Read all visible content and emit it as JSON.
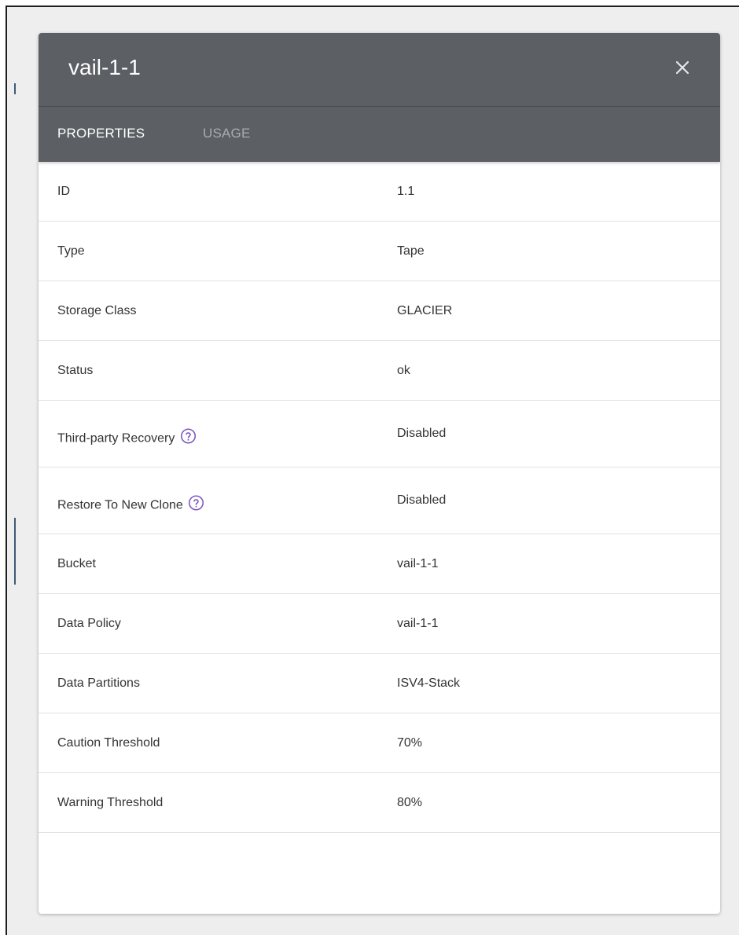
{
  "dialog": {
    "title": "vail-1-1",
    "close_icon": "close-icon"
  },
  "tabs": [
    {
      "label": "PROPERTIES",
      "active": true
    },
    {
      "label": "USAGE",
      "active": false
    }
  ],
  "properties": [
    {
      "label": "ID",
      "value": "1.1"
    },
    {
      "label": "Type",
      "value": "Tape"
    },
    {
      "label": "Storage Class",
      "value": "GLACIER"
    },
    {
      "label": "Status",
      "value": "ok"
    },
    {
      "label": "Third-party Recovery",
      "value": "Disabled",
      "help_icon": "help-circle-icon"
    },
    {
      "label": "Restore To New Clone",
      "value": "Disabled",
      "help_icon": "help-circle-icon"
    },
    {
      "label": "Bucket",
      "value": "vail-1-1"
    },
    {
      "label": "Data Policy",
      "value": "vail-1-1"
    },
    {
      "label": "Data Partitions",
      "value": "ISV4-Stack"
    },
    {
      "label": "Caution Threshold",
      "value": "70%"
    },
    {
      "label": "Warning Threshold",
      "value": "80%"
    }
  ],
  "colors": {
    "header_bg": "#5c5f63",
    "help_icon": "#7e57c2",
    "page_bg": "#eeeeee"
  }
}
